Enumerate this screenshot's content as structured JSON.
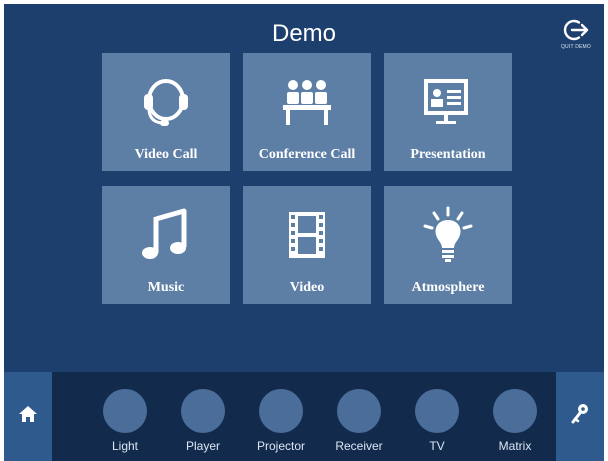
{
  "header": {
    "title": "Demo",
    "quit_label": "QUIT DEMO"
  },
  "scenes": [
    {
      "label": "Video Call",
      "icon": "headset-icon"
    },
    {
      "label": "Conference Call",
      "icon": "meeting-icon"
    },
    {
      "label": "Presentation",
      "icon": "presentation-screen-icon"
    },
    {
      "label": "Music",
      "icon": "music-note-icon"
    },
    {
      "label": "Video",
      "icon": "film-strip-icon"
    },
    {
      "label": "Atmosphere",
      "icon": "lightbulb-icon"
    }
  ],
  "bottom_bar": {
    "home_icon": "home-icon",
    "settings_icon": "key-icon",
    "devices": [
      {
        "label": "Light"
      },
      {
        "label": "Player"
      },
      {
        "label": "Projector"
      },
      {
        "label": "Receiver"
      },
      {
        "label": "TV"
      },
      {
        "label": "Matrix"
      }
    ]
  },
  "colors": {
    "background": "#1d3f6e",
    "tile": "#5d7fa6",
    "bottom_bar": "#122b4d",
    "side_button": "#2e5a8e",
    "device_circle": "#4b6d9a"
  }
}
